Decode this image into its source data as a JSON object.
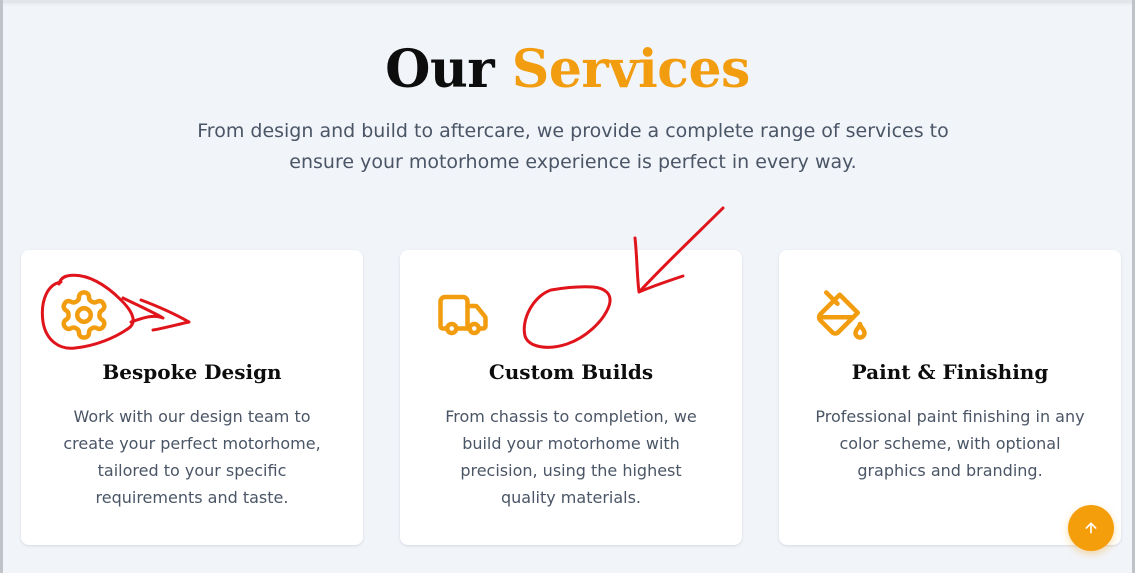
{
  "section": {
    "title_main": "Our",
    "title_accent": "Services",
    "subtitle": "From design and build to aftercare, we provide a complete range of services to ensure your motorhome experience is perfect in every way."
  },
  "services": [
    {
      "icon": "gear-icon",
      "title": "Bespoke Design",
      "description": "Work with our design team to create your perfect motorhome, tailored to your specific requirements and taste."
    },
    {
      "icon": "truck-icon",
      "title": "Custom Builds",
      "description": "From chassis to completion, we build your motorhome with precision, using the highest quality materials."
    },
    {
      "icon": "paint-bucket-icon",
      "title": "Paint & Finishing",
      "description": "Professional paint finishing in any color scheme, with optional graphics and branding."
    }
  ],
  "scroll_top": {
    "icon": "arrow-up-icon"
  },
  "colors": {
    "accent": "#f29c0f",
    "background": "#f1f4f9",
    "card": "#ffffff",
    "heading": "#0d0d0d",
    "body_text": "#4a5566",
    "annotation": "#e0141b"
  }
}
